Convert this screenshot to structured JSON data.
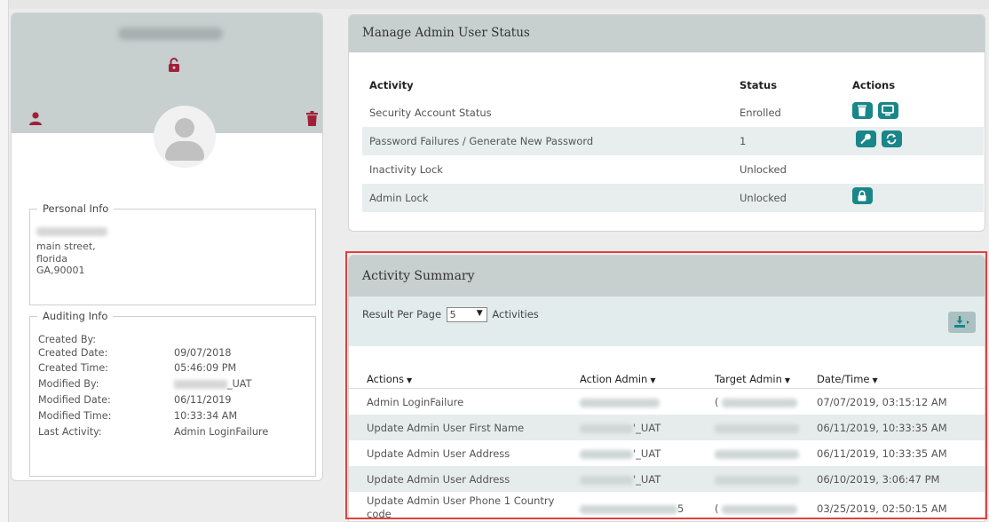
{
  "profile": {
    "icons": {
      "unlock": "unlock-icon",
      "user": "user-icon",
      "trash": "trash-icon",
      "avatar": "avatar-placeholder"
    },
    "colors": {
      "accent": "#a0203a",
      "header_bg": "#c7cfcf"
    },
    "personal_info": {
      "legend": "Personal Info",
      "address_line1": "main street,",
      "address_line2": "florida",
      "address_line3": "GA,90001"
    },
    "auditing_info": {
      "legend": "Auditing Info",
      "rows": [
        {
          "label": "Created By:",
          "value": ""
        },
        {
          "label": "Created Date:",
          "value": "09/07/2018"
        },
        {
          "label": "Created Time:",
          "value": "05:46:09 PM"
        },
        {
          "label": "Modified By:",
          "value": "_UAT"
        },
        {
          "label": "Modified Date:",
          "value": "06/11/2019"
        },
        {
          "label": "Modified Time:",
          "value": "10:33:34 AM"
        },
        {
          "label": "Last Activity:",
          "value": "Admin LoginFailure"
        }
      ]
    }
  },
  "manage": {
    "title": "Manage Admin User Status",
    "headers": {
      "activity": "Activity",
      "status": "Status",
      "actions": "Actions"
    },
    "rows": [
      {
        "activity": "Security Account Status",
        "status": "Enrolled",
        "actions": [
          "trash-icon",
          "monitor-icon"
        ]
      },
      {
        "activity": "Password Failures / Generate New Password",
        "status": "1",
        "actions": [
          "key-icon",
          "refresh-icon"
        ]
      },
      {
        "activity": "Inactivity Lock",
        "status": "Unlocked",
        "actions": []
      },
      {
        "activity": "Admin Lock",
        "status": "Unlocked",
        "actions": [
          "lock-icon"
        ]
      }
    ],
    "action_color": "#19868a"
  },
  "activity": {
    "title": "Activity Summary",
    "result_per_page_label": "Result Per Page",
    "per_page_value": "5",
    "activities_label": "Activities",
    "export_icon": "download-icon",
    "headers": {
      "actions": "Actions",
      "action_admin": "Action Admin",
      "target_admin": "Target Admin",
      "datetime": "Date/Time"
    },
    "rows": [
      {
        "action": "Admin LoginFailure",
        "action_admin": "",
        "target_admin": "(",
        "datetime": "07/07/2019, 03:15:12 AM"
      },
      {
        "action": "Update Admin User First Name",
        "action_admin": "'_UAT",
        "target_admin": "",
        "datetime": "06/11/2019, 10:33:35 AM"
      },
      {
        "action": "Update Admin User Address",
        "action_admin": "'_UAT",
        "target_admin": "",
        "datetime": "06/11/2019, 10:33:35 AM"
      },
      {
        "action": "Update Admin User Address",
        "action_admin": "'_UAT",
        "target_admin": "",
        "datetime": "06/10/2019, 3:06:47 PM"
      },
      {
        "action": "Update Admin User Phone 1 Country",
        "action_continued": "code",
        "action_admin": "5",
        "target_admin": "(",
        "datetime": "03/25/2019, 02:50:15 AM"
      }
    ],
    "highlight_color": "#e0403f"
  }
}
